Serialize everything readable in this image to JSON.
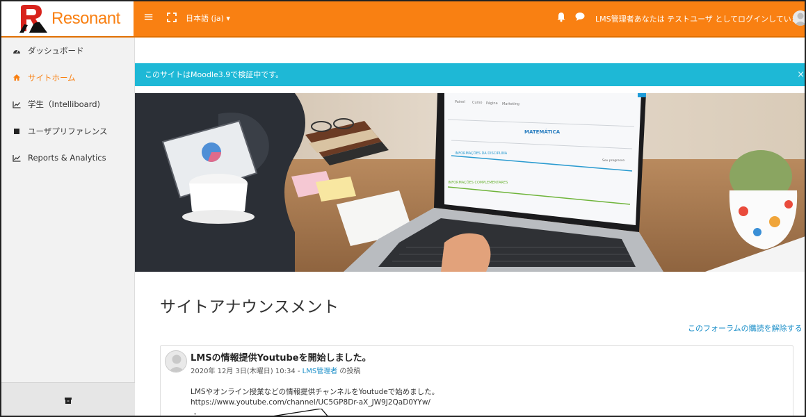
{
  "brand": {
    "name": "Resonant",
    "accent": "#f98012",
    "logo_red": "#d8231c"
  },
  "navbar": {
    "menu_icon": "hamburger-icon",
    "fullscreen_icon": "fullscreen-icon",
    "language": "日本語 (ja) ▾",
    "bell_icon": "bell-icon",
    "chat_icon": "chat-icon",
    "user_text": "LMS管理者あなたは テストユーザ としてログインしています"
  },
  "sidebar": {
    "items": [
      {
        "label": "ダッシュボード",
        "icon": "dashboard-icon",
        "active": false
      },
      {
        "label": "サイトホーム",
        "icon": "home-icon",
        "active": true
      },
      {
        "label": "学生（Intelliboard)",
        "icon": "line-chart-icon",
        "active": false
      },
      {
        "label": "ユーザプリファレンス",
        "icon": "square-bullet-icon",
        "active": false
      },
      {
        "label": "Reports & Analytics",
        "icon": "line-chart-icon",
        "active": false
      }
    ],
    "bottom_icon": "archive-icon"
  },
  "alert": {
    "text": "このサイトはMoodle3.9で検証中です。",
    "close": "×",
    "color": "#1eb8d6"
  },
  "hero": {
    "screen_tabs": [
      "Painel",
      "Curso",
      "Página",
      "Marketing"
    ],
    "screen_heading": "MATEMÁTICA",
    "screen_section1": "INFORMAÇÕES DA DISCIPLINA",
    "screen_section2": "INFORMAÇÕES COMPLEMENTARES",
    "screen_progress": "Seu progresso"
  },
  "announcements": {
    "title": "サイトアナウンスメント",
    "unsubscribe": "このフォーラムの購読を解除する",
    "post": {
      "title": "LMSの情報提供Youtubeを開始しました。",
      "meta_date": "2020年 12月 3日(木曜日) 10:34 - ",
      "meta_author": "LMS管理者",
      "meta_suffix": " の投稿",
      "body_line1": "LMSやオンライン授業などの情報提供チャンネルをYoutudeで始めました。",
      "body_line2": "https://www.youtube.com/channel/UC5GP8Dr-aX_JW9J2QaD0YYw/",
      "bullet": "・"
    }
  }
}
